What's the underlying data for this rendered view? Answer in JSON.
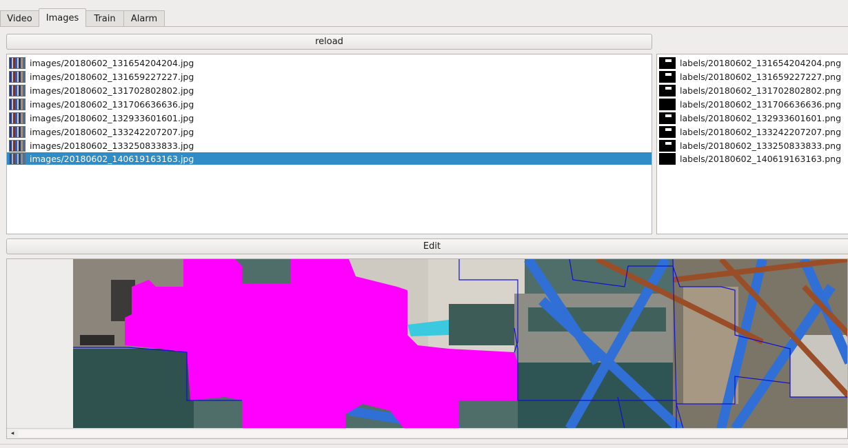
{
  "tabs": [
    {
      "label": "Video"
    },
    {
      "label": "Images"
    },
    {
      "label": "Train"
    },
    {
      "label": "Alarm"
    }
  ],
  "active_tab": "Images",
  "reload_label": "reload",
  "edit_label": "Edit",
  "images": [
    {
      "name": "images/20180602_131654204204.jpg"
    },
    {
      "name": "images/20180602_131659227227.jpg"
    },
    {
      "name": "images/20180602_131702802802.jpg"
    },
    {
      "name": "images/20180602_131706636636.jpg"
    },
    {
      "name": "images/20180602_132933601601.jpg"
    },
    {
      "name": "images/20180602_133242207207.jpg"
    },
    {
      "name": "images/20180602_133250833833.jpg"
    },
    {
      "name": "images/20180602_140619163163.jpg"
    }
  ],
  "labels": [
    {
      "name": "labels/20180602_131654204204.png"
    },
    {
      "name": "labels/20180602_131659227227.png"
    },
    {
      "name": "labels/20180602_131702802802.png"
    },
    {
      "name": "labels/20180602_131706636636.png"
    },
    {
      "name": "labels/20180602_132933601601.png"
    },
    {
      "name": "labels/20180602_133242207207.png"
    },
    {
      "name": "labels/20180602_133250833833.png"
    },
    {
      "name": "labels/20180602_140619163163.png"
    }
  ],
  "selected_image": "images/20180602_140619163163.jpg",
  "colors": {
    "selection": "#308cc6",
    "mask": "#ff00ff",
    "segment_outline": "#1010d0"
  },
  "icons": {
    "scroll_left": "◂"
  }
}
